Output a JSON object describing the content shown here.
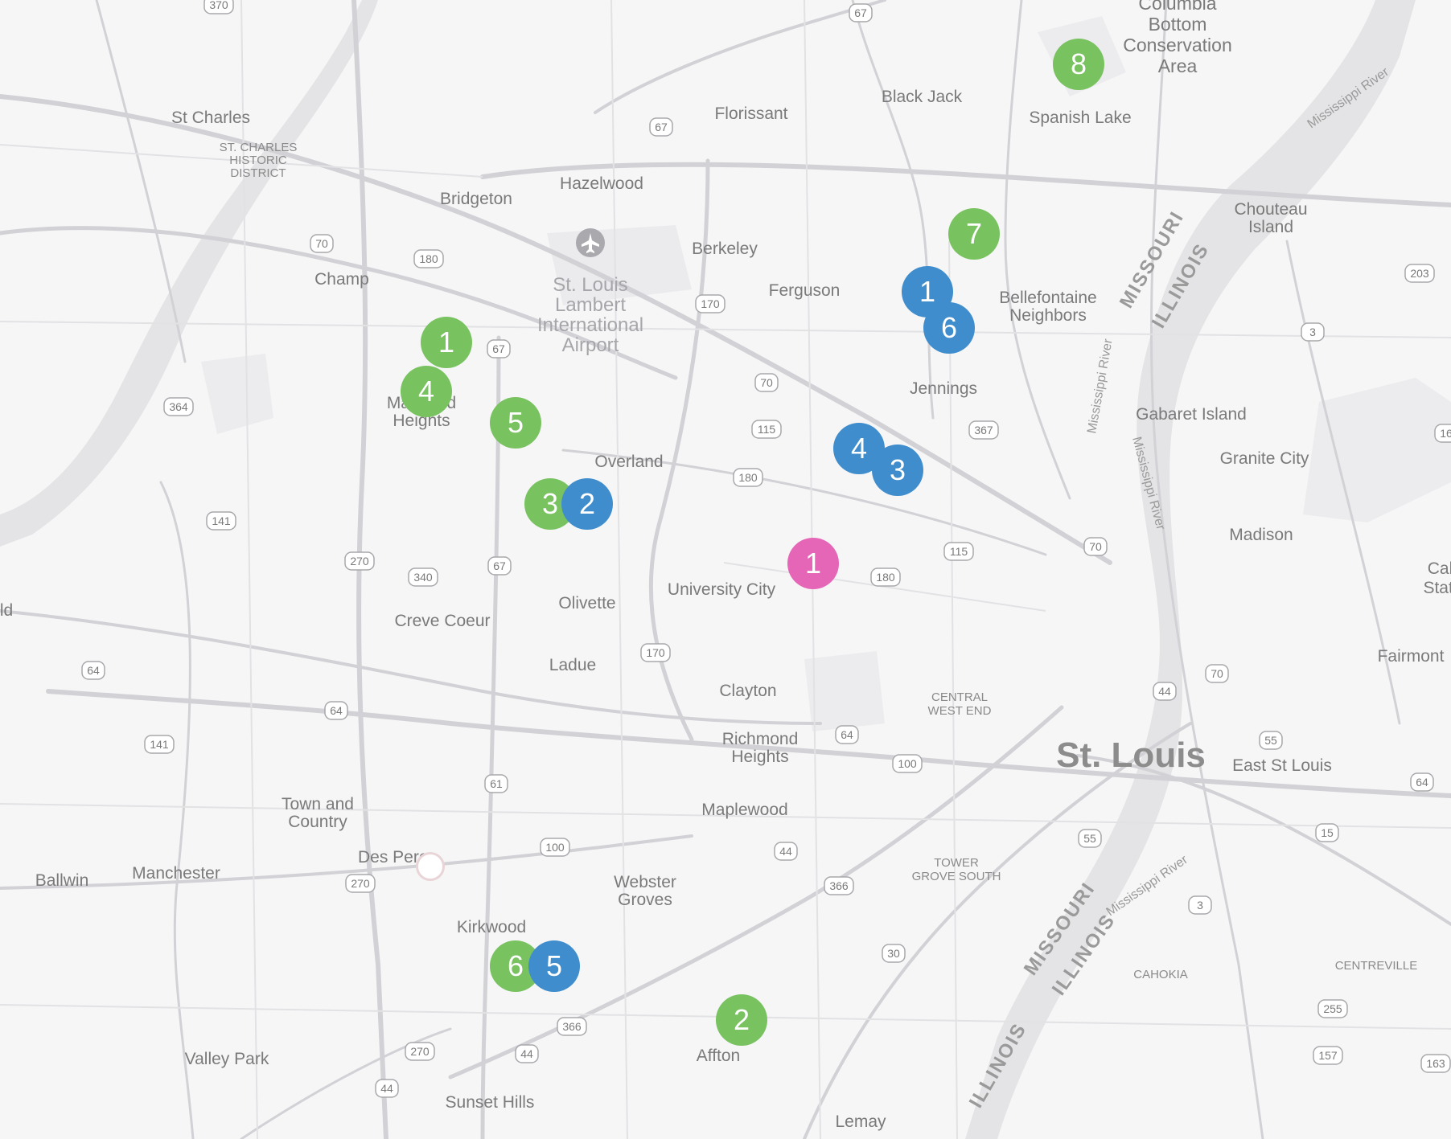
{
  "colors": {
    "green": "#79c260",
    "blue": "#3f8dcc",
    "pink": "#e566b7",
    "water": "#e4e4e6",
    "road": "#d4d4d8",
    "label": "#7a7a7a"
  },
  "places": {
    "st_louis": "St. Louis",
    "east_st_louis": "East St Louis",
    "st_charles": "St Charles",
    "st_charles_district": [
      "ST. CHARLES",
      "HISTORIC",
      "DISTRICT"
    ],
    "florissant": "Florissant",
    "black_jack": "Black Jack",
    "spanish_lake": "Spanish Lake",
    "columbia_bottom": [
      "Columbia",
      "Bottom",
      "Conservation",
      "Area"
    ],
    "hazelwood": "Hazelwood",
    "bridgeton": "Bridgeton",
    "berkeley": "Berkeley",
    "ferguson": "Ferguson",
    "champ": "Champ",
    "airport": [
      "St. Louis",
      "Lambert",
      "International",
      "Airport"
    ],
    "bellefontaine": [
      "Bellefontaine",
      "Neighbors"
    ],
    "chouteau_island": [
      "Chouteau",
      "Island"
    ],
    "jennings": "Jennings",
    "gabaret_island": "Gabaret Island",
    "granite_city": "Granite City",
    "madison": "Madison",
    "maryland_heights": [
      "Maryland",
      "Heights"
    ],
    "overland": "Overland",
    "university_city": "University City",
    "olivette": "Olivette",
    "creve_coeur": "Creve Coeur",
    "ladue": "Ladue",
    "clayton": "Clayton",
    "central_west_end": [
      "CENTRAL",
      "WEST END"
    ],
    "richmond_heights": [
      "Richmond",
      "Heights"
    ],
    "fairmont": "Fairmont",
    "cahokia_state": [
      "Cah",
      "State"
    ],
    "town_and_country": [
      "Town and",
      "Country"
    ],
    "maplewood": "Maplewood",
    "des_peres": "Des Peres",
    "ballwin": "Ballwin",
    "manchester": "Manchester",
    "webster_groves": [
      "Webster",
      "Groves"
    ],
    "tower_grove_south": [
      "TOWER",
      "GROVE SOUTH"
    ],
    "kirkwood": "Kirkwood",
    "cahokia": "CAHOKIA",
    "centreville": "CENTREVILLE",
    "affton": "Affton",
    "valley_park": "Valley Park",
    "sunset_hills": "Sunset Hills",
    "lemay": "Lemay",
    "ld": "ld"
  },
  "states": {
    "missouri": "MISSOURI",
    "illinois": "ILLINOIS"
  },
  "rivers": {
    "mississippi": "Mississippi River"
  },
  "shields": [
    "370",
    "67",
    "67",
    "67",
    "70",
    "180",
    "170",
    "70",
    "115",
    "180",
    "364",
    "367",
    "141",
    "270",
    "67",
    "340",
    "115",
    "180",
    "70",
    "203",
    "3",
    "64",
    "64",
    "170",
    "64",
    "141",
    "100",
    "61",
    "44",
    "70",
    "55",
    "55",
    "64",
    "270",
    "100",
    "44",
    "15",
    "366",
    "30",
    "44",
    "3",
    "366",
    "270",
    "44",
    "255",
    "157",
    "163",
    "16"
  ],
  "markers": [
    {
      "label": "8",
      "color": "green"
    },
    {
      "label": "7",
      "color": "green"
    },
    {
      "label": "1",
      "color": "blue"
    },
    {
      "label": "6",
      "color": "blue"
    },
    {
      "label": "1",
      "color": "green"
    },
    {
      "label": "4",
      "color": "green"
    },
    {
      "label": "5",
      "color": "green"
    },
    {
      "label": "4",
      "color": "blue"
    },
    {
      "label": "3",
      "color": "blue"
    },
    {
      "label": "3",
      "color": "green"
    },
    {
      "label": "2",
      "color": "blue"
    },
    {
      "label": "1",
      "color": "pink"
    },
    {
      "label": "6",
      "color": "green"
    },
    {
      "label": "5",
      "color": "blue"
    },
    {
      "label": "2",
      "color": "green"
    }
  ],
  "icons": {
    "airport": "airplane-icon",
    "favorite": "heart-icon"
  }
}
